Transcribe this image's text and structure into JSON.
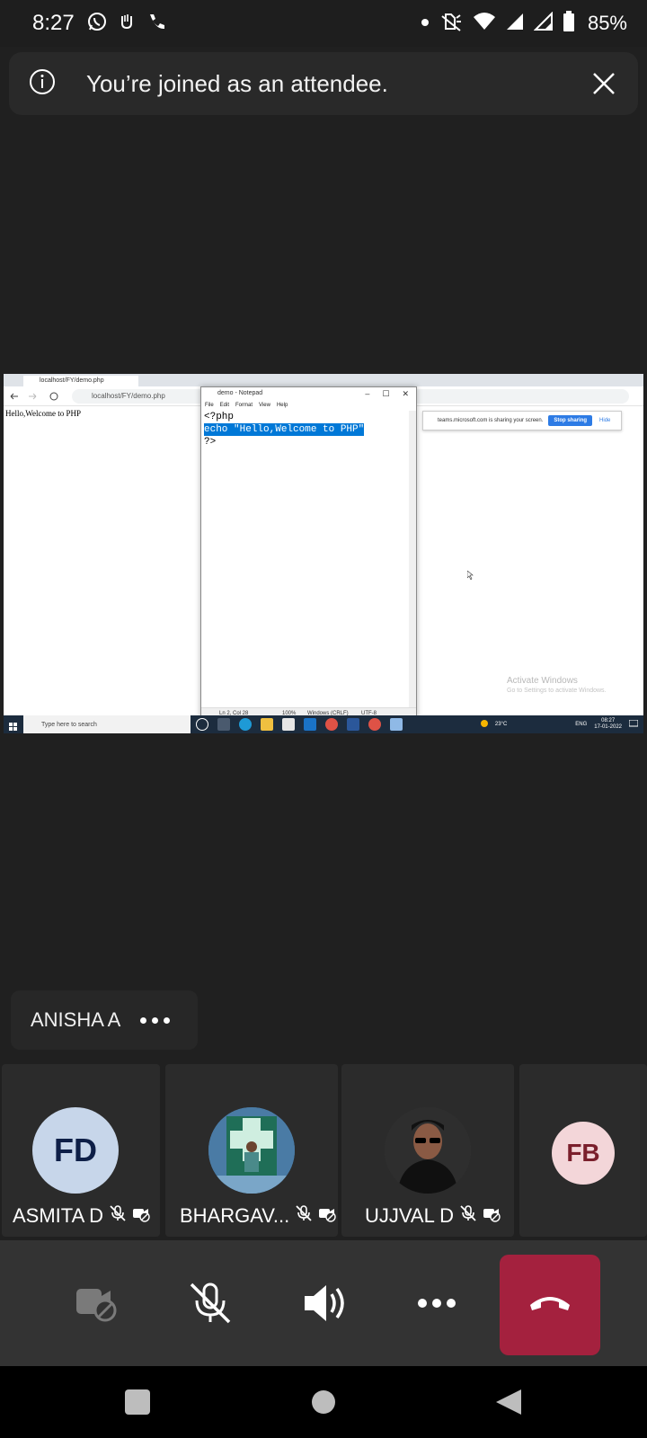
{
  "status_bar": {
    "time": "8:27",
    "battery": "85%",
    "icons_left": [
      "whatsapp-icon",
      "teams-icon",
      "phone-icon"
    ],
    "icons_right": [
      "dot-icon",
      "vibrate-icon",
      "wifi-icon",
      "signal-icon",
      "signal-icon",
      "battery-icon"
    ]
  },
  "banner": {
    "text": "You’re joined as an attendee.",
    "icons": [
      "info-icon",
      "close-icon"
    ]
  },
  "shared_screen": {
    "browser": {
      "tab_title": "localhost/FY/demo.php",
      "url": "localhost/FY/demo.php",
      "page_text": "Hello,Welcome to PHP"
    },
    "share_notice": {
      "text": "teams.microsoft.com is sharing your screen.",
      "stop_label": "Stop sharing",
      "hide_label": "Hide",
      "accent_color": "#2d7be5"
    },
    "notepad": {
      "title": "demo - Notepad",
      "menu": [
        "File",
        "Edit",
        "Format",
        "View",
        "Help"
      ],
      "lines": [
        "<?php",
        "echo \"Hello,Welcome to PHP\"",
        "?>"
      ],
      "status": {
        "position": "Ln 2, Col 28",
        "zoom": "100%",
        "line_ending": "Windows (CRLF)",
        "encoding": "UTF-8"
      }
    },
    "watermark": {
      "title": "Activate Windows",
      "subtitle": "Go to Settings to activate Windows."
    },
    "taskbar": {
      "search_placeholder": "Type here to search",
      "weather": "23°C",
      "language": "ENG",
      "time": "08:27",
      "date": "17-01-2022"
    }
  },
  "speaker": {
    "name": "ANISHA A"
  },
  "participants": [
    {
      "initials": "FD",
      "name": "ASMITA D",
      "avatar_bg": "#c7d6ea",
      "avatar_fg": "#0e1f47"
    },
    {
      "initials": "",
      "name": "BHARGAV...",
      "avatar_bg": "#4a7ba5",
      "avatar_fg": "#ffffff"
    },
    {
      "initials": "",
      "name": "UJJVAL D",
      "avatar_bg": "#3a3a3a",
      "avatar_fg": "#ffffff"
    },
    {
      "initials": "FB",
      "name": "",
      "avatar_bg": "#f3d6d9",
      "avatar_fg": "#7a1f2c"
    }
  ],
  "controls": {
    "icons": [
      "camera-off-icon",
      "mic-off-icon",
      "speaker-icon",
      "more-icon",
      "hang-up-icon"
    ],
    "hangup_color": "#a4213e"
  },
  "navbar": {
    "icons": [
      "recents-icon",
      "home-icon",
      "back-icon"
    ]
  }
}
